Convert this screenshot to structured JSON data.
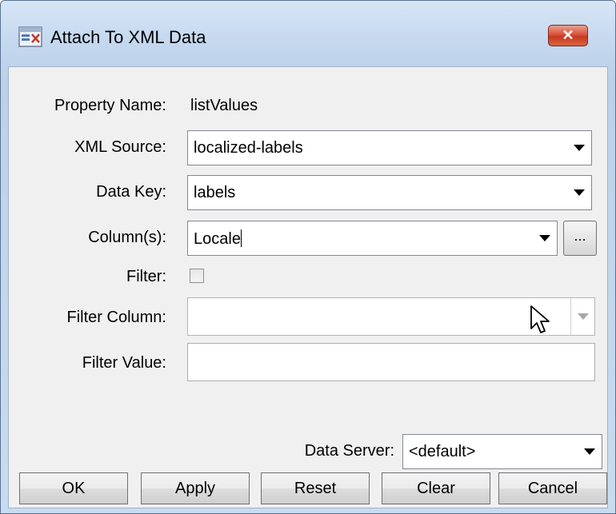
{
  "window": {
    "title": "Attach To XML Data",
    "close_label": "✕",
    "icon": "xml-data-icon"
  },
  "form": {
    "property_name": {
      "label": "Property Name:",
      "value": "listValues"
    },
    "xml_source": {
      "label": "XML Source:",
      "value": "localized-labels"
    },
    "data_key": {
      "label": "Data Key:",
      "value": "labels"
    },
    "columns": {
      "label": "Column(s):",
      "value": "Locale",
      "ellipsis_label": "..."
    },
    "filter": {
      "label": "Filter:",
      "checked": false
    },
    "filter_column": {
      "label": "Filter Column:",
      "value": ""
    },
    "filter_value": {
      "label": "Filter Value:",
      "value": ""
    },
    "data_server": {
      "label": "Data Server:",
      "value": "<default>"
    }
  },
  "buttons": {
    "ok": "OK",
    "apply": "Apply",
    "reset": "Reset",
    "clear": "Clear",
    "cancel": "Cancel"
  }
}
